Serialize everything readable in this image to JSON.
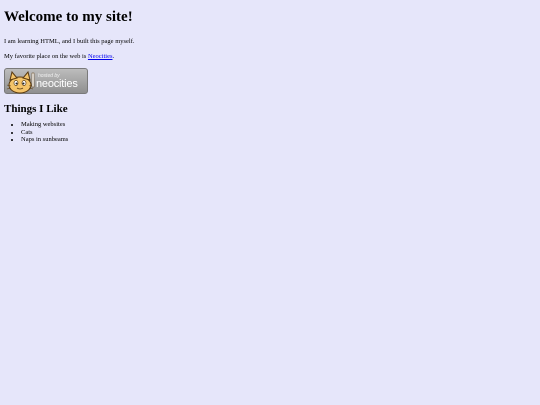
{
  "page": {
    "title": "Welcome to my site!",
    "intro": "I am learning HTML, and I built this page myself.",
    "favorite_prefix": "My favorite place on the web is ",
    "favorite_link": "Neocities",
    "favorite_suffix": "."
  },
  "badge": {
    "hosted_text": "hosted by",
    "brand_text": "neocities",
    "icon": "neocities-cat-icon"
  },
  "likes": {
    "heading": "Things I Like",
    "items": [
      "Making websites",
      "Cats",
      "Naps in sunbeams"
    ]
  },
  "colors": {
    "background": "#e6e6fa",
    "link": "#0000ee",
    "badge": "#a8a8a8"
  }
}
